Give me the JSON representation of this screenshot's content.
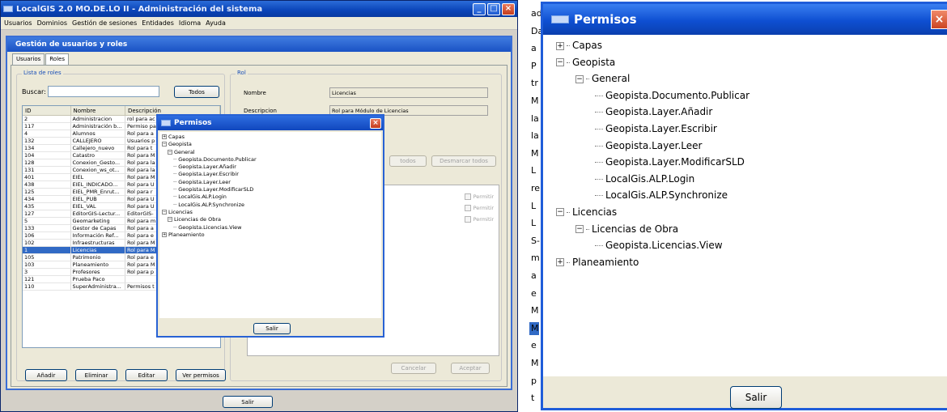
{
  "main_window": {
    "title": "LocalGIS 2.0 MO.DE.LO II - Administración del sistema",
    "menu": [
      "Usuarios",
      "Dominios",
      "Gestión de sesiones",
      "Entidades",
      "Idioma",
      "Ayuda"
    ],
    "inner_title": "Gestión de usuarios y roles",
    "tabs": [
      "Usuarios",
      "Roles"
    ],
    "active_tab": "Roles",
    "roles_list": {
      "group_label": "Lista de roles",
      "search_label": "Buscar:",
      "search_value": "",
      "todos_button": "Todos",
      "columns": [
        "ID",
        "Nombre",
        "Descripción"
      ],
      "rows": [
        [
          "2",
          "Administracion",
          "rol para ac"
        ],
        [
          "117",
          "Administración b...",
          "Permiso pa"
        ],
        [
          "4",
          "Alumnos",
          "Rol para a"
        ],
        [
          "132",
          "CALLEJERO",
          "Usuarios p"
        ],
        [
          "134",
          "Callejero_nuevo",
          "Rol para t"
        ],
        [
          "104",
          "Catastro",
          "Rol para M"
        ],
        [
          "128",
          "Conexion_Gesto...",
          "Rol para la"
        ],
        [
          "131",
          "Conexion_ws_ot...",
          "Rol para la"
        ],
        [
          "401",
          "EIEL",
          "Rol para M"
        ],
        [
          "438",
          "EIEL_INDICADO...",
          "Rol para U"
        ],
        [
          "125",
          "EIEL_PMR_Enrut...",
          "Rol para r"
        ],
        [
          "434",
          "EIEL_PUB",
          "Rol para U"
        ],
        [
          "435",
          "EIEL_VAL",
          "Rol para U"
        ],
        [
          "127",
          "EditorGIS-Lectur...",
          "EditorGIS-"
        ],
        [
          "5",
          "Geomarketing",
          "Rol para m"
        ],
        [
          "133",
          "Gestor de Capas",
          "Rol para a"
        ],
        [
          "106",
          "Información Ref...",
          "Rol para e"
        ],
        [
          "102",
          "Infraestructuras",
          "Rol para M"
        ],
        [
          "1",
          "Licencias",
          "Rol para M"
        ],
        [
          "105",
          "Patrimonio",
          "Rol para e"
        ],
        [
          "103",
          "Planeamiento",
          "Rol para M"
        ],
        [
          "3",
          "Profesores",
          "Rol para p"
        ],
        [
          "121",
          "Prueba Paco",
          ""
        ],
        [
          "110",
          "SuperAdministra...",
          "Permisos t"
        ]
      ],
      "selected_row": 18,
      "buttons": [
        "Añadir",
        "Eliminar",
        "Editar",
        "Ver permisos"
      ]
    },
    "rol_panel": {
      "group_label": "Rol",
      "nombre_label": "Nombre",
      "nombre_value": "Licencias",
      "descripcion_label": "Descripcion",
      "descripcion_value": "Rol para Módulo de Licencias",
      "marcar_todos": "todos",
      "desmarcar_todos": "Desmarcar todos",
      "permitir": [
        "Permitir",
        "Permitir",
        "Permitir"
      ],
      "cancelar": "Cancelar",
      "aceptar": "Aceptar"
    },
    "salir": "Salir"
  },
  "permisos_dialog": {
    "title": "Permisos",
    "tree": [
      {
        "label": "Capas",
        "level": 0,
        "state": "collapsed"
      },
      {
        "label": "Geopista",
        "level": 0,
        "state": "expanded"
      },
      {
        "label": "General",
        "level": 1,
        "state": "expanded"
      },
      {
        "label": "Geopista.Documento.Publicar",
        "level": 2,
        "state": "leaf"
      },
      {
        "label": "Geopista.Layer.Añadir",
        "level": 2,
        "state": "leaf"
      },
      {
        "label": "Geopista.Layer.Escribir",
        "level": 2,
        "state": "leaf"
      },
      {
        "label": "Geopista.Layer.Leer",
        "level": 2,
        "state": "leaf"
      },
      {
        "label": "Geopista.Layer.ModificarSLD",
        "level": 2,
        "state": "leaf"
      },
      {
        "label": "LocalGis.ALP.Login",
        "level": 2,
        "state": "leaf"
      },
      {
        "label": "LocalGis.ALP.Synchronize",
        "level": 2,
        "state": "leaf"
      },
      {
        "label": "Licencias",
        "level": 0,
        "state": "expanded"
      },
      {
        "label": "Licencias de Obra",
        "level": 1,
        "state": "expanded"
      },
      {
        "label": "Geopista.Licencias.View",
        "level": 2,
        "state": "leaf"
      },
      {
        "label": "Planeamiento",
        "level": 0,
        "state": "collapsed"
      }
    ],
    "salir": "Salir"
  },
  "background_strip": [
    "ad",
    "Da",
    "a",
    "P",
    "tr",
    "M",
    "la",
    "la",
    "M",
    "L",
    "re",
    "L",
    "L",
    "S-",
    "m",
    "a",
    "e",
    "M",
    "M",
    "e",
    "M",
    "p",
    "t"
  ],
  "colors": {
    "title_blue": "#0a44b8",
    "selection_blue": "#316ac5",
    "window_bg": "#ece9d8"
  }
}
